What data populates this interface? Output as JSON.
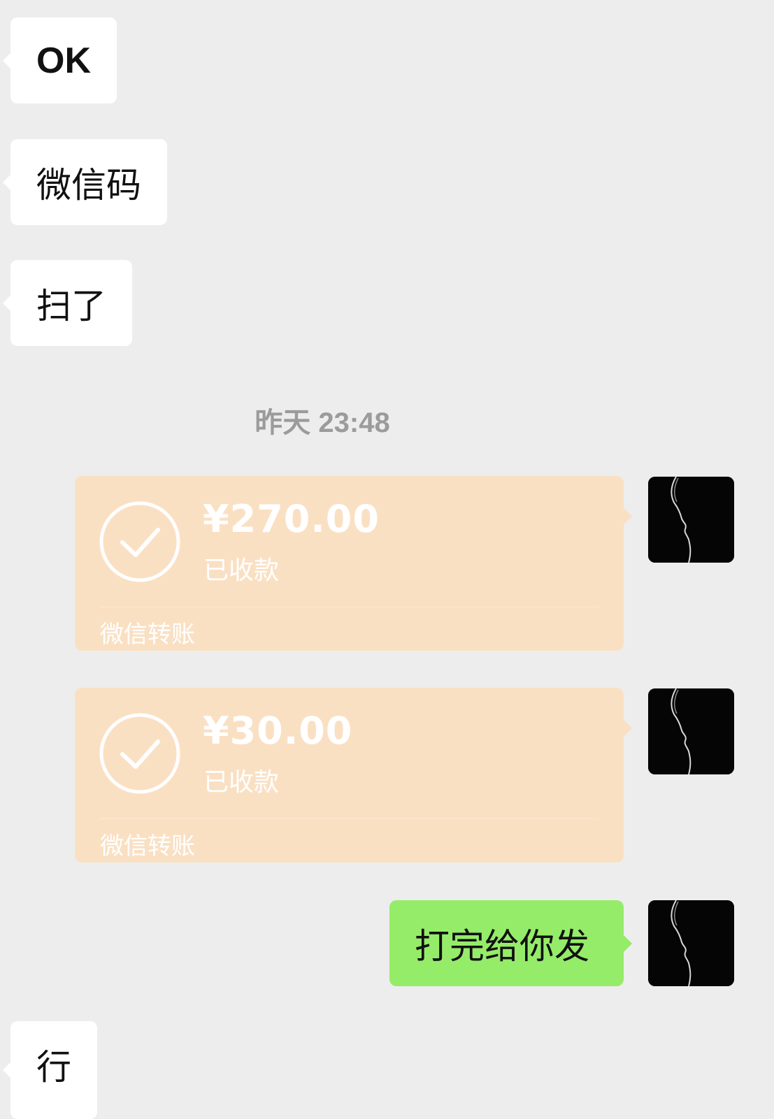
{
  "messages": {
    "m1": "OK",
    "m2": "微信码",
    "m3": "扫了",
    "m4": "打完给你发",
    "m5": "行"
  },
  "timestamp": "昨天 23:48",
  "transfers": [
    {
      "amount": "¥270.00",
      "status": "已收款",
      "source": "微信转账"
    },
    {
      "amount": "¥30.00",
      "status": "已收款",
      "source": "微信转账"
    }
  ],
  "colors": {
    "background": "#ededed",
    "incoming_bubble": "#ffffff",
    "outgoing_bubble": "#95ec69",
    "transfer_received": "#fae0c3"
  },
  "icons": {
    "transfer_status": "check-circle-icon",
    "avatar": "silhouette-profile-avatar"
  }
}
